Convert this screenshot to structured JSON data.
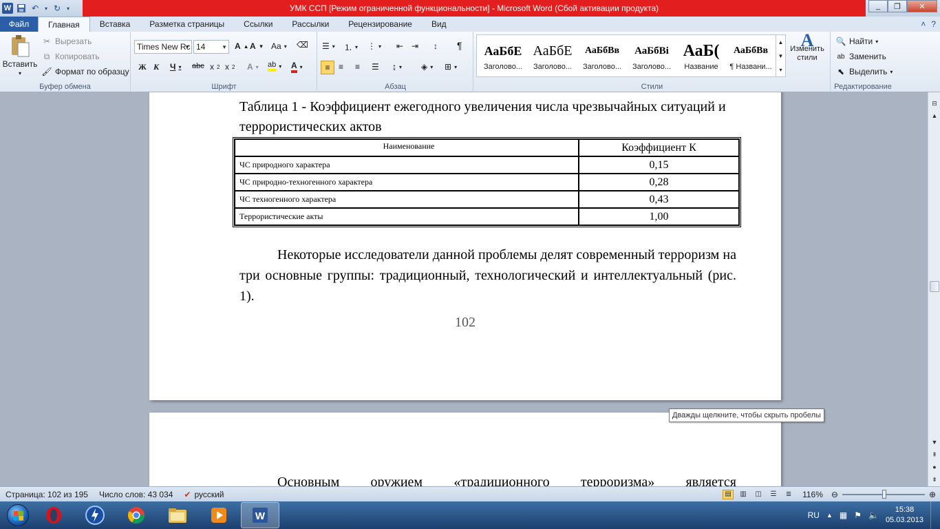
{
  "window": {
    "title": "УМК ССП [Режим ограниченной функциональности]  -  Microsoft Word (Сбой активации продукта)",
    "app_letter": "W"
  },
  "tabs": [
    {
      "label": "Файл"
    },
    {
      "label": "Главная"
    },
    {
      "label": "Вставка"
    },
    {
      "label": "Разметка страницы"
    },
    {
      "label": "Ссылки"
    },
    {
      "label": "Рассылки"
    },
    {
      "label": "Рецензирование"
    },
    {
      "label": "Вид"
    }
  ],
  "ribbon": {
    "clipboard": {
      "label": "Буфер обмена",
      "paste": "Вставить",
      "cut": "Вырезать",
      "copy": "Копировать",
      "format_painter": "Формат по образцу"
    },
    "font": {
      "label": "Шрифт",
      "font_name": "Times New Rc",
      "font_size": "14",
      "case_btn": "Aa"
    },
    "paragraph": {
      "label": "Абзац"
    },
    "styles": {
      "label": "Стили",
      "items": [
        {
          "sample": "АаБбЕ",
          "name": "Заголово..."
        },
        {
          "sample": "АаБбЕ",
          "name": "Заголово..."
        },
        {
          "sample": "АаБбВв",
          "name": "Заголово..."
        },
        {
          "sample": "АаБбВі",
          "name": "Заголово..."
        },
        {
          "sample": "АаБ(",
          "name": "Название"
        },
        {
          "sample": "АаБбВв",
          "name": "¶ Названи..."
        }
      ],
      "change_styles": "Изменить стили"
    },
    "editing": {
      "label": "Редактирование",
      "find": "Найти",
      "replace": "Заменить",
      "select": "Выделить"
    }
  },
  "document": {
    "caption": "Таблица 1 - Коэффициент ежегодного увеличения числа чрезвычайных ситуаций  и террористических актов",
    "table": {
      "headers": [
        "Наименование",
        "Коэффициент К"
      ],
      "rows": [
        [
          "ЧС природного характера",
          "0,15"
        ],
        [
          "ЧС природно-техногенного характера",
          "0,28"
        ],
        [
          "ЧС техногенного характера",
          "0,43"
        ],
        [
          "Террористические акты",
          "1,00"
        ]
      ]
    },
    "paragraph": "Некоторые исследователи данной проблемы делят современный терроризм на три основные группы: традиционный, технологический и интеллектуальный (рис. 1).",
    "page_number": "102",
    "next_page_start": "Основным оружием «традиционного терроризма» является",
    "tooltip": "Дважды щелкните, чтобы скрыть пробелы"
  },
  "statusbar": {
    "page": "Страница: 102 из 195",
    "words": "Число слов: 43 034",
    "language": "русский",
    "zoom": "116%"
  },
  "taskbar": {
    "lang": "RU",
    "time": "15:38",
    "date": "05.03.2013"
  },
  "colors": {
    "title_alert": "#e31e1e",
    "file_tab": "#2a5fa8"
  }
}
